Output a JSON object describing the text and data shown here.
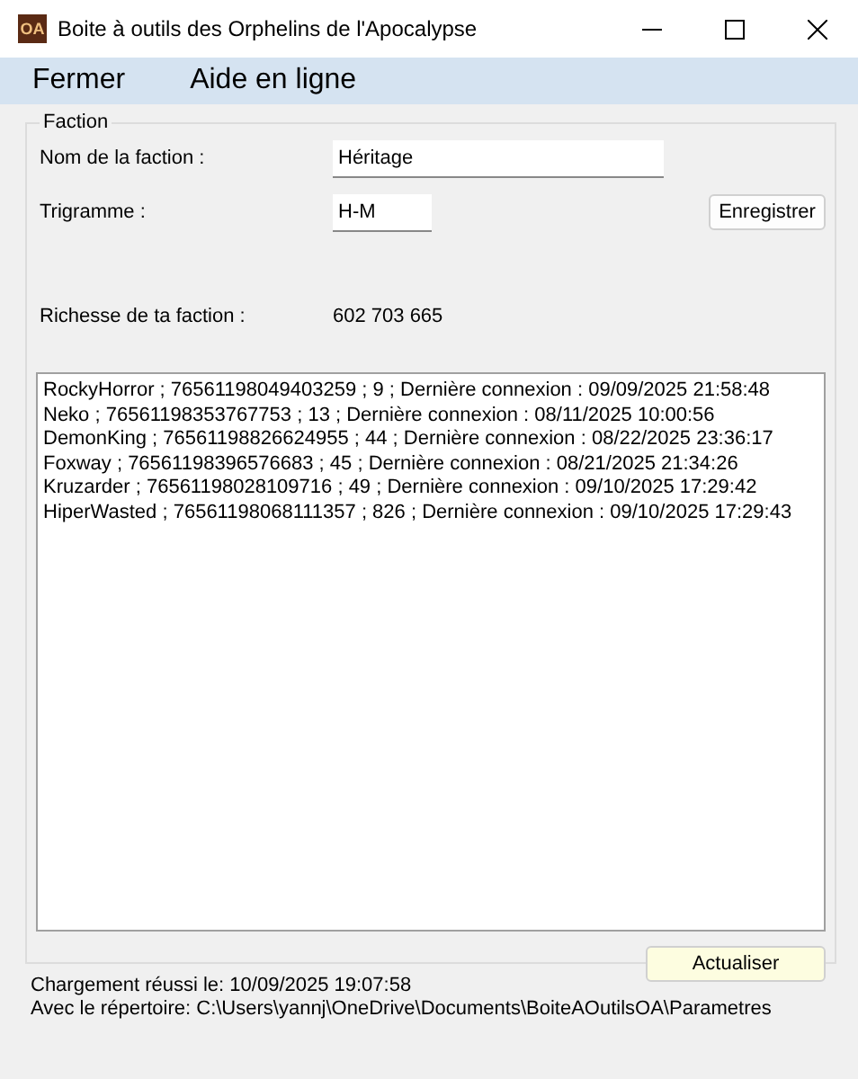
{
  "window": {
    "icon_text": "OA",
    "title": "Boite à outils des Orphelins de l'Apocalypse"
  },
  "menu": [
    "Fermer",
    "Aide en ligne"
  ],
  "group": {
    "title": "Faction",
    "name_label": "Nom de la faction :",
    "name_value": "Héritage",
    "trigram_label": "Trigramme :",
    "trigram_value": "H-M",
    "save_button": "Enregistrer",
    "wealth_label": "Richesse de ta faction :",
    "wealth_value": "602 703 665",
    "members": [
      "RockyHorror ; 76561198049403259 ; 9 ; Dernière connexion : 09/09/2025 21:58:48",
      "Neko ; 76561198353767753 ; 13 ; Dernière connexion : 08/11/2025 10:00:56",
      "DemonKing ; 76561198826624955 ; 44 ; Dernière connexion : 08/22/2025 23:36:17",
      "Foxway ; 76561198396576683 ; 45 ; Dernière connexion : 08/21/2025 21:34:26",
      "Kruzarder ; 76561198028109716 ; 49 ; Dernière connexion : 09/10/2025 17:29:42",
      "HiperWasted ; 76561198068111357 ; 826 ; Dernière connexion : 09/10/2025 17:29:43"
    ],
    "refresh_button": "Actualiser"
  },
  "status_lines": [
    "Chargement réussi le: 10/09/2025 19:07:58",
    "Avec le répertoire: C:\\Users\\yannj\\OneDrive\\Documents\\BoiteAOutilsOA\\Parametres"
  ]
}
